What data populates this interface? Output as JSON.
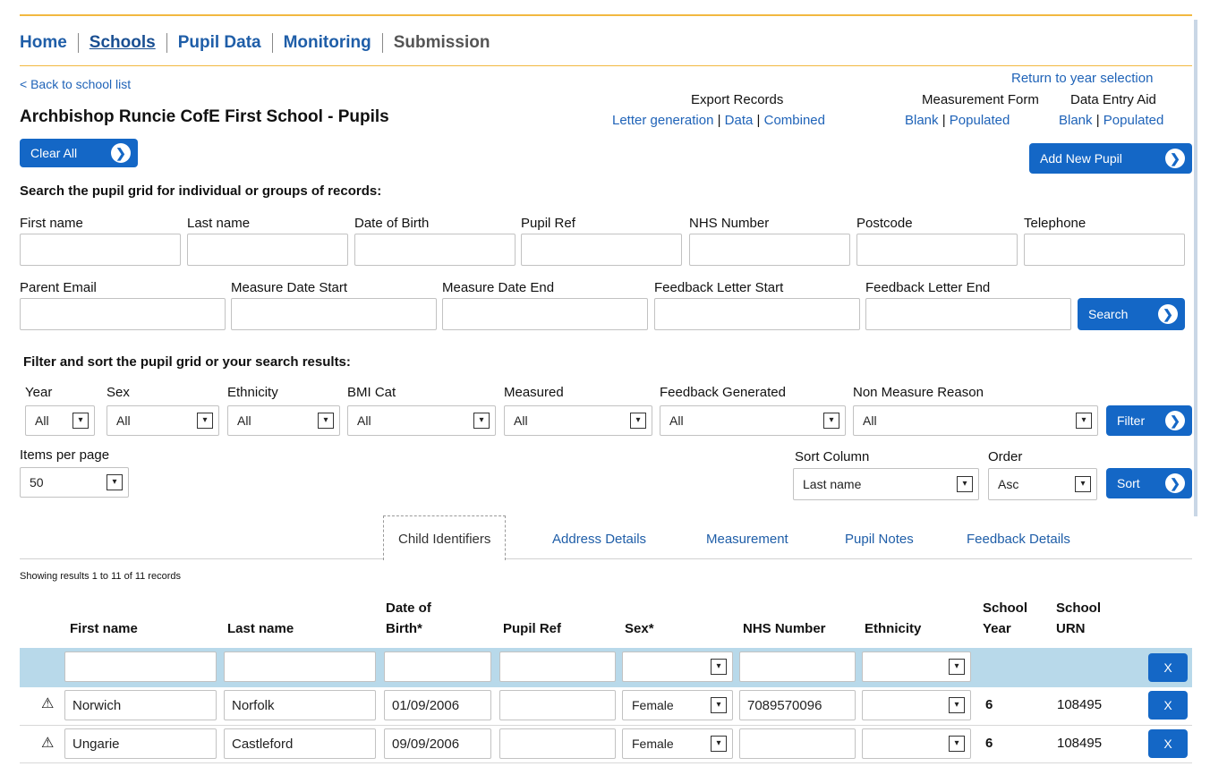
{
  "nav": {
    "items": [
      {
        "label": "Home"
      },
      {
        "label": "Schools"
      },
      {
        "label": "Pupil Data"
      },
      {
        "label": "Monitoring"
      },
      {
        "label": "Submission"
      }
    ]
  },
  "header": {
    "back_link": "< Back to school list",
    "title": "Archbishop Runcie CofE First School - Pupils",
    "return_link": "Return to year selection"
  },
  "exports": {
    "export_records": {
      "title": "Export Records",
      "links": [
        "Letter generation",
        "Data",
        "Combined"
      ]
    },
    "measurement_form": {
      "title": "Measurement Form",
      "links": [
        "Blank",
        "Populated"
      ]
    },
    "data_entry_aid": {
      "title": "Data Entry Aid",
      "links": [
        "Blank",
        "Populated"
      ]
    },
    "sep": "|"
  },
  "buttons": {
    "clear_all": "Clear All",
    "add_new_pupil": "Add New Pupil",
    "search": "Search",
    "filter": "Filter",
    "sort": "Sort",
    "delete": "X"
  },
  "search": {
    "heading": "Search the pupil grid for individual or groups of records:",
    "row1": [
      "First name",
      "Last name",
      "Date of Birth",
      "Pupil Ref",
      "NHS Number",
      "Postcode",
      "Telephone"
    ],
    "row2": [
      "Parent Email",
      "Measure Date Start",
      "Measure Date End",
      "Feedback Letter Start",
      "Feedback Letter End"
    ]
  },
  "filter": {
    "heading": "Filter and sort the pupil grid or your search results:",
    "labels": [
      "Year",
      "Sex",
      "Ethnicity",
      "BMI Cat",
      "Measured",
      "Feedback Generated",
      "Non Measure Reason"
    ],
    "values": [
      "All",
      "All",
      "All",
      "All",
      "All",
      "All",
      "All"
    ],
    "items_per_page_label": "Items per page",
    "items_per_page": "50",
    "sort_column_label": "Sort Column",
    "sort_column": "Last name",
    "order_label": "Order",
    "order": "Asc"
  },
  "tabs": [
    "Child Identifiers",
    "Address Details",
    "Measurement",
    "Pupil Notes",
    "Feedback Details"
  ],
  "results": {
    "summary": "Showing results 1 to 11 of 11 records",
    "columns": {
      "first_name": "First name",
      "last_name": "Last name",
      "dob_1": "Date of",
      "dob_2": "Birth*",
      "pupil_ref": "Pupil Ref",
      "sex": "Sex*",
      "nhs": "NHS Number",
      "ethnicity": "Ethnicity",
      "year_1": "School",
      "year_2": "Year",
      "urn_1": "School",
      "urn_2": "URN"
    },
    "rows": [
      {
        "first_name": "Norwich",
        "last_name": "Norfolk",
        "dob": "01/09/2006",
        "pupil_ref": "",
        "sex": "Female",
        "nhs": "7089570096",
        "ethnicity": "",
        "year": "6",
        "urn": "108495"
      },
      {
        "first_name": "Ungarie",
        "last_name": "Castleford",
        "dob": "09/09/2006",
        "pupil_ref": "",
        "sex": "Female",
        "nhs": "",
        "ethnicity": "",
        "year": "6",
        "urn": "108495"
      }
    ]
  },
  "icons": {
    "dropdown": "▾",
    "arrow": "❯",
    "warning": "⚠"
  },
  "colors": {
    "brand_blue": "#1467c6",
    "link_blue": "#1f5ea8",
    "accent_line": "#f2b840",
    "filter_row_bg": "#b8d9ea"
  }
}
